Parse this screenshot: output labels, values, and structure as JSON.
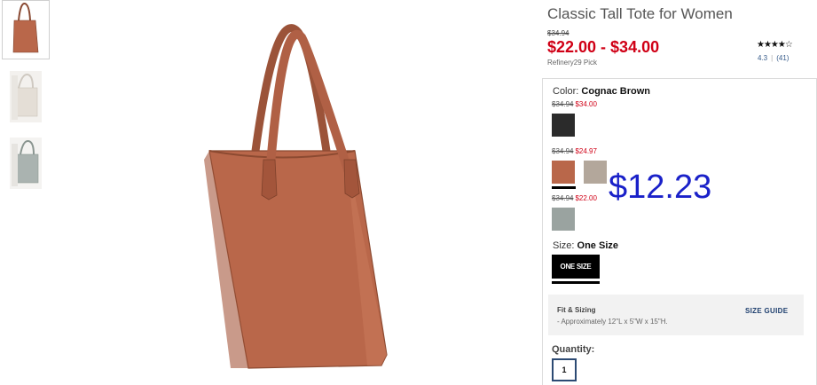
{
  "product": {
    "title": "Classic Tall Tote for Women",
    "original_price": "$34.94",
    "price_range": "$22.00 - $34.00",
    "pick": "Refinery29 Pick",
    "stars": "★★★★☆",
    "rating": "4.3",
    "review_count": "(41)"
  },
  "color": {
    "label": "Color:",
    "selected": "Cognac Brown",
    "price_rows": [
      {
        "old": "$34.94",
        "new": "$34.00"
      },
      {
        "old": "$34.94",
        "new": "$24.97"
      },
      {
        "old": "$34.94",
        "new": "$22.00"
      }
    ],
    "swatches": [
      {
        "name": "black",
        "color": "#2b2b2b"
      },
      {
        "name": "cognac-brown",
        "color": "#b9674a"
      },
      {
        "name": "taupe",
        "color": "#b3a79b"
      },
      {
        "name": "gray",
        "color": "#9aa3a0"
      }
    ]
  },
  "overlay_price": "$12.23",
  "size": {
    "label": "Size:",
    "selected": "One Size",
    "button": "ONE SIZE"
  },
  "fit": {
    "title": "Fit & Sizing",
    "text": "- Approximately 12\"L x 5\"W x 15\"H.",
    "guide": "SIZE GUIDE"
  },
  "quantity": {
    "label": "Quantity:",
    "value": "1"
  },
  "colors": {
    "sale_red": "#d00016",
    "overlay_blue": "#1a21c9",
    "bag_cognac": "#b9674a"
  }
}
